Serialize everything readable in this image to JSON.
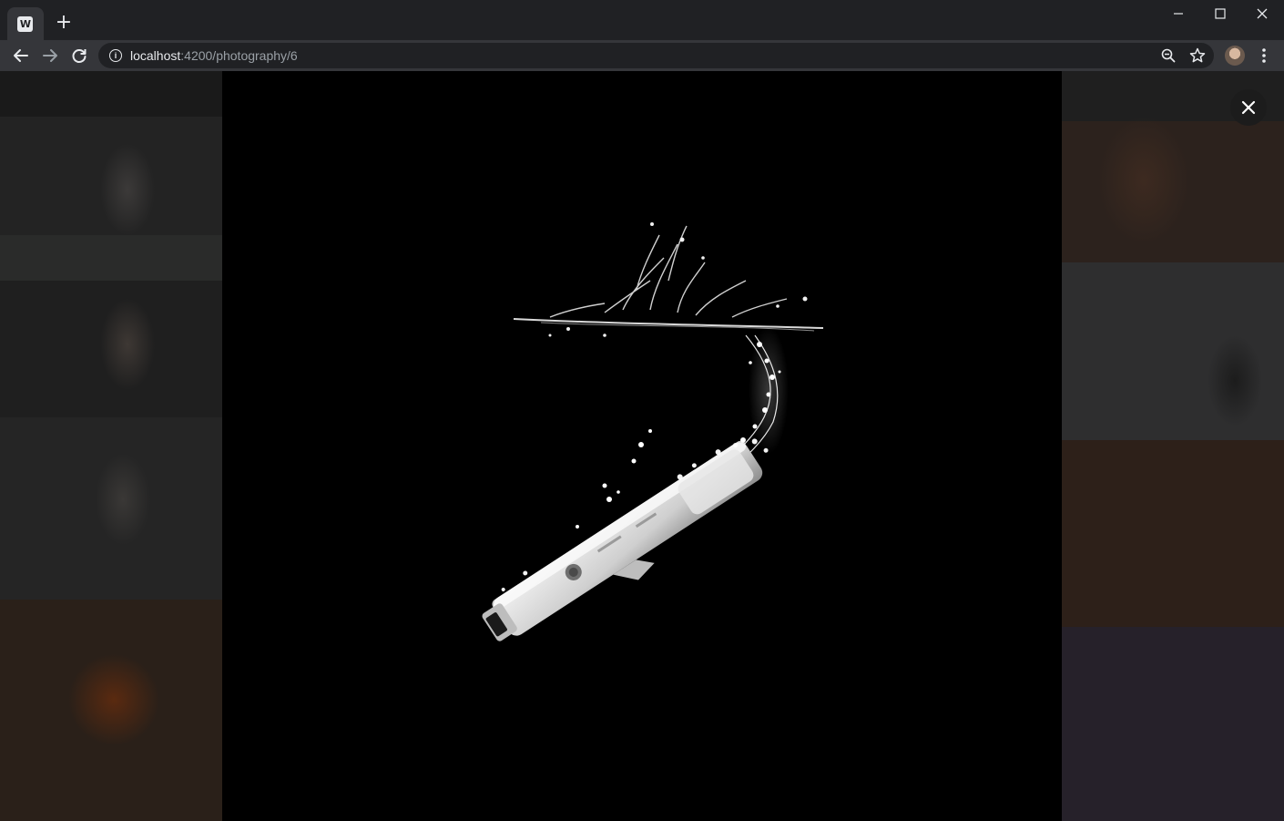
{
  "browser": {
    "tab": {
      "favicon_text": "W"
    },
    "new_tab_label": "+",
    "address_bar": {
      "host": "localhost",
      "rest": ":4200/photography/6"
    }
  },
  "page": {
    "lightbox": {
      "photo_subject": "white-game-controller-splashing-into-water",
      "close_icon": "close-icon"
    }
  },
  "icons": {
    "back": "arrow-left-icon",
    "forward": "arrow-right-icon",
    "reload": "reload-icon",
    "info": "info-icon",
    "zoom": "zoom-out-icon",
    "bookmark": "star-icon",
    "menu": "kebab-menu-icon"
  },
  "colors": {
    "chrome_bg": "#202124",
    "toolbar_bg": "#35363a",
    "lightbox_bg": "#000000"
  }
}
